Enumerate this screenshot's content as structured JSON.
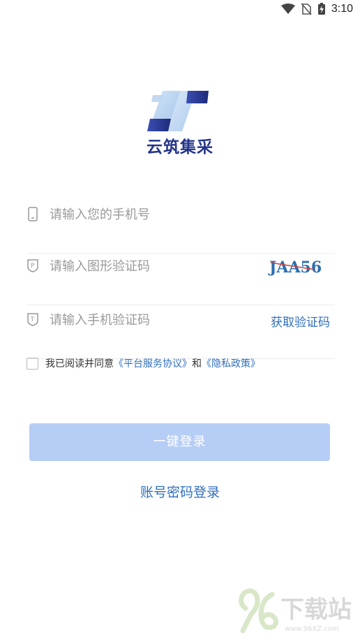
{
  "status_bar": {
    "time": "3:10"
  },
  "app": {
    "logo_text": "云筑集采"
  },
  "form": {
    "phone_placeholder": "请输入您的手机号",
    "captcha_placeholder": "请输入图形验证码",
    "captcha_text": "JAA56",
    "sms_placeholder": "请输入手机验证码",
    "get_code_label": "获取验证码"
  },
  "agreement": {
    "prefix": "我已阅读并同意",
    "link1": "《平台服务协议》",
    "conj": "和",
    "link2": "《隐私政策》"
  },
  "buttons": {
    "one_click_login": "一键登录",
    "password_login": "账号密码登录"
  },
  "watermark": {
    "text": "下载站",
    "url": "www.96XZ.com"
  },
  "colors": {
    "brand": "#24358a",
    "link": "#2f6fbf",
    "button_disabled": "#b6cdf5"
  }
}
